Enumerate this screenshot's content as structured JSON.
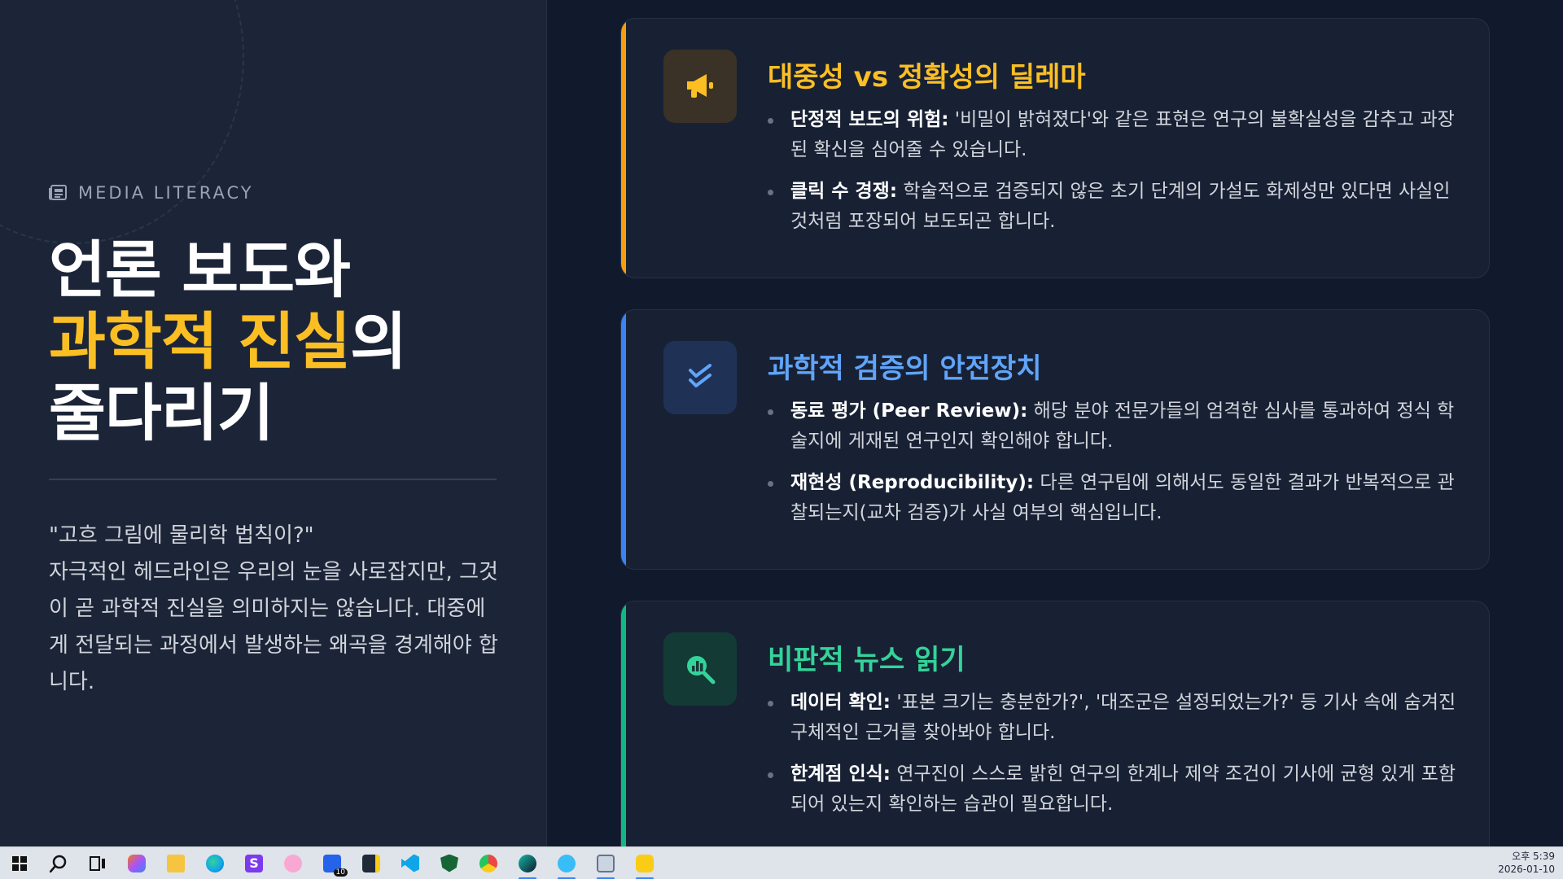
{
  "left": {
    "kicker": "MEDIA LITERACY",
    "headline_line1": "언론 보도와",
    "headline_accent": "과학적 진실",
    "headline_suffix": "의",
    "headline_line3": "줄다리기",
    "quote": "\"고흐 그림에 물리학 법칙이?\"",
    "intro": "자극적인 헤드라인은 우리의 눈을 사로잡지만, 그것이 곧 과학적 진실을 의미하지는 않습니다. 대중에게 전달되는 과정에서 발생하는 왜곡을 경계해야 합니다."
  },
  "cards": [
    {
      "title": "대중성 vs 정확성의 딜레마",
      "icon": "megaphone-icon",
      "items": [
        {
          "label": "단정적 보도의 위험:",
          "text": " '비밀이 밝혀졌다'와 같은 표현은 연구의 불확실성을 감추고 과장된 확신을 심어줄 수 있습니다."
        },
        {
          "label": "클릭 수 경쟁:",
          "text": " 학술적으로 검증되지 않은 초기 단계의 가설도 화제성만 있다면 사실인 것처럼 포장되어 보도되곤 합니다."
        }
      ]
    },
    {
      "title": "과학적 검증의 안전장치",
      "icon": "double-check-icon",
      "items": [
        {
          "label": "동료 평가 (Peer Review):",
          "text": " 해당 분야 전문가들의 엄격한 심사를 통과하여 정식 학술지에 게재된 연구인지 확인해야 합니다."
        },
        {
          "label": "재현성 (Reproducibility):",
          "text": " 다른 연구팀에 의해서도 동일한 결과가 반복적으로 관찰되는지(교차 검증)가 사실 여부의 핵심입니다."
        }
      ]
    },
    {
      "title": "비판적 뉴스 읽기",
      "icon": "search-chart-icon",
      "items": [
        {
          "label": "데이터 확인:",
          "text": " '표본 크기는 충분한가?', '대조군은 설정되었는가?' 등 기사 속에 숨겨진 구체적인 근거를 찾아봐야 합니다."
        },
        {
          "label": "한계점 인식:",
          "text": " 연구진이 스스로 밝힌 연구의 한계나 제약 조건이 기사에 균형 있게 포함되어 있는지 확인하는 습관이 필요합니다."
        }
      ]
    }
  ],
  "taskbar": {
    "badge_count": "10",
    "time": "오후 5:39",
    "date": "2026-01-10"
  }
}
